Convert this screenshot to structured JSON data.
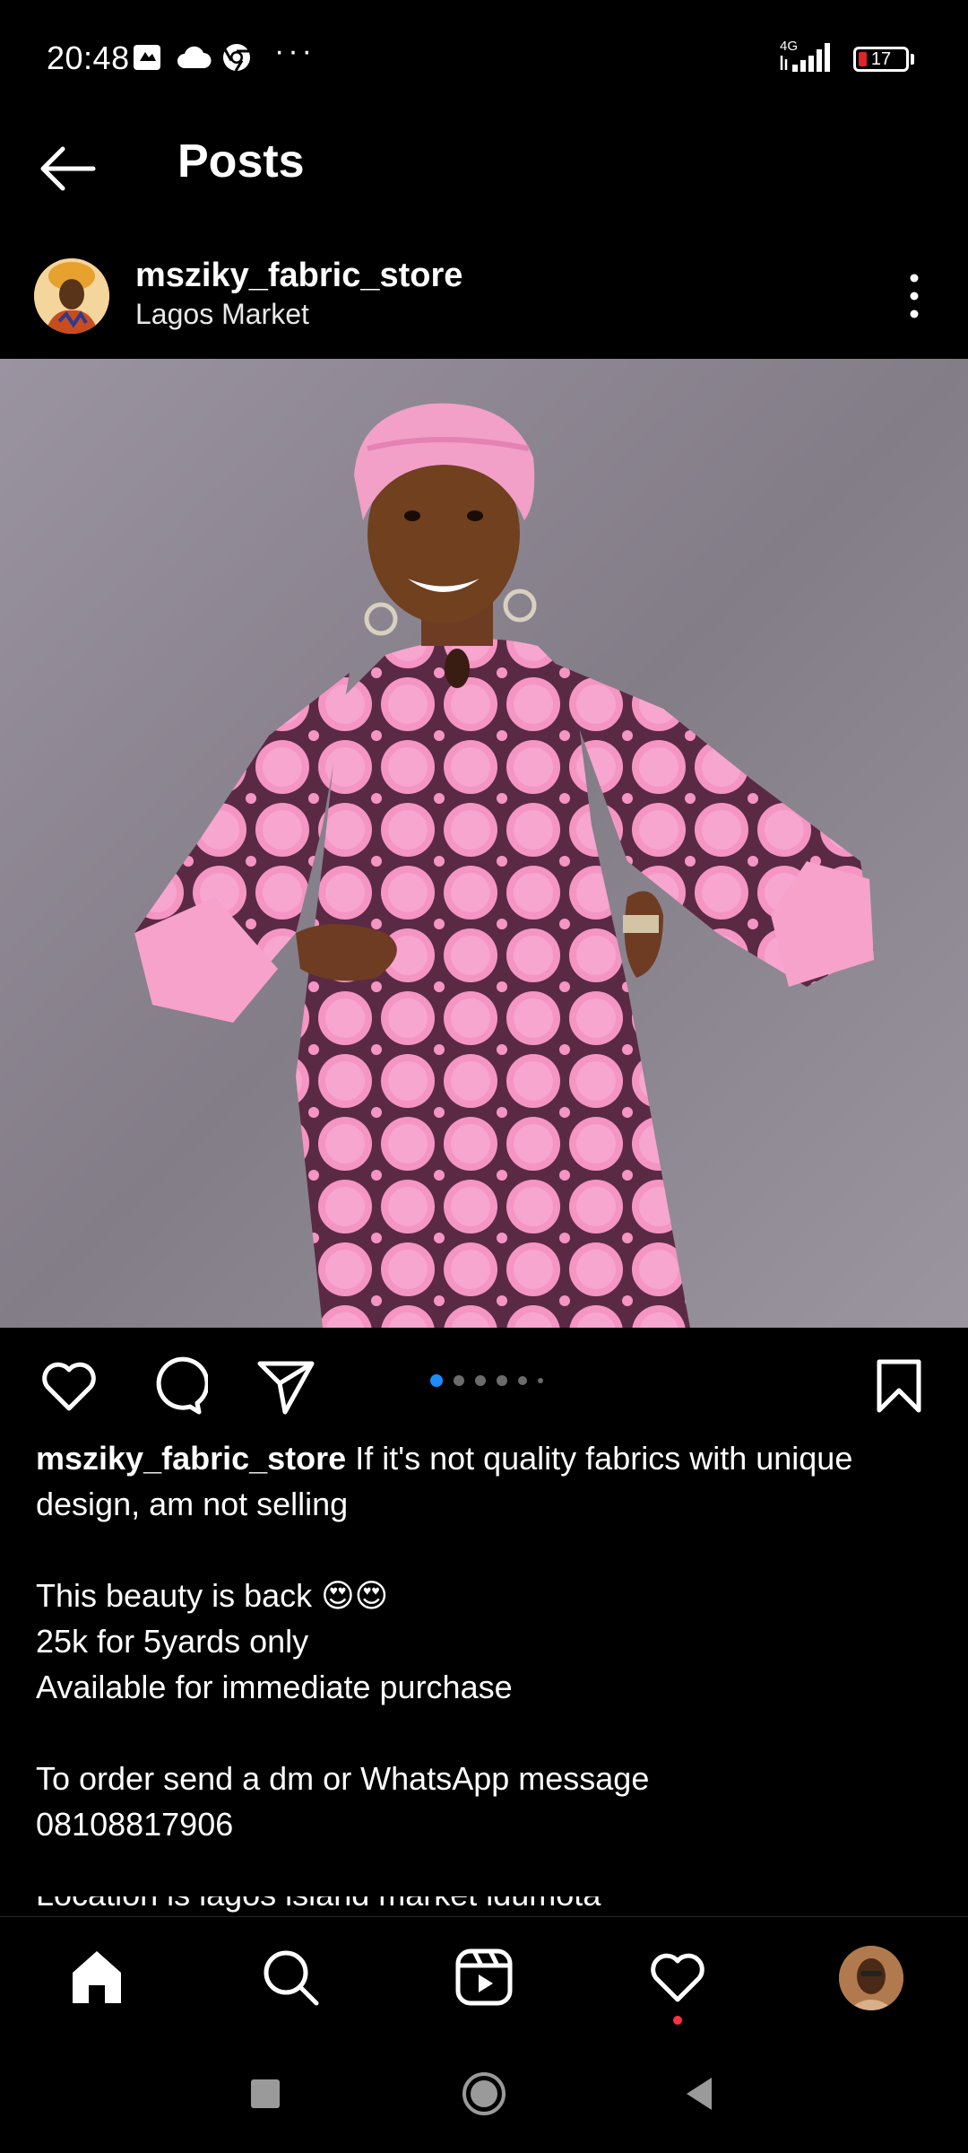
{
  "status_bar": {
    "time": "20:48",
    "icons": [
      "notification-icon",
      "cloud-icon",
      "chrome-icon"
    ],
    "more": "···",
    "network": "4G",
    "battery_level": "17",
    "battery_color": "#e0242b"
  },
  "header": {
    "title": "Posts"
  },
  "post": {
    "username": "mszikyfabricstore",
    "username_display": "mszikyfabricstore",
    "location": "Lagos Market",
    "carousel": {
      "count": 6,
      "active_index": 0,
      "active_color": "#1d8cf8"
    },
    "caption": {
      "username": "msziky_fabric_store",
      "first_line": " If it's not quality fabrics with  unique design, am not selling",
      "lines_block1": [
        "This beauty is back 😍😍",
        "25k for 5yards only",
        "Available for immediate purchase"
      ],
      "lines_block2": [
        "To order send a dm or WhatsApp message",
        "08108817906"
      ],
      "cut_line": "Location is lagos island market idumota"
    }
  },
  "bottom_nav": {
    "items": [
      "home-icon",
      "search-icon",
      "reels-icon",
      "activity-icon",
      "profile-avatar"
    ],
    "notification_color": "#ff3040"
  },
  "system_nav": [
    "recents-button",
    "home-button",
    "back-button"
  ]
}
